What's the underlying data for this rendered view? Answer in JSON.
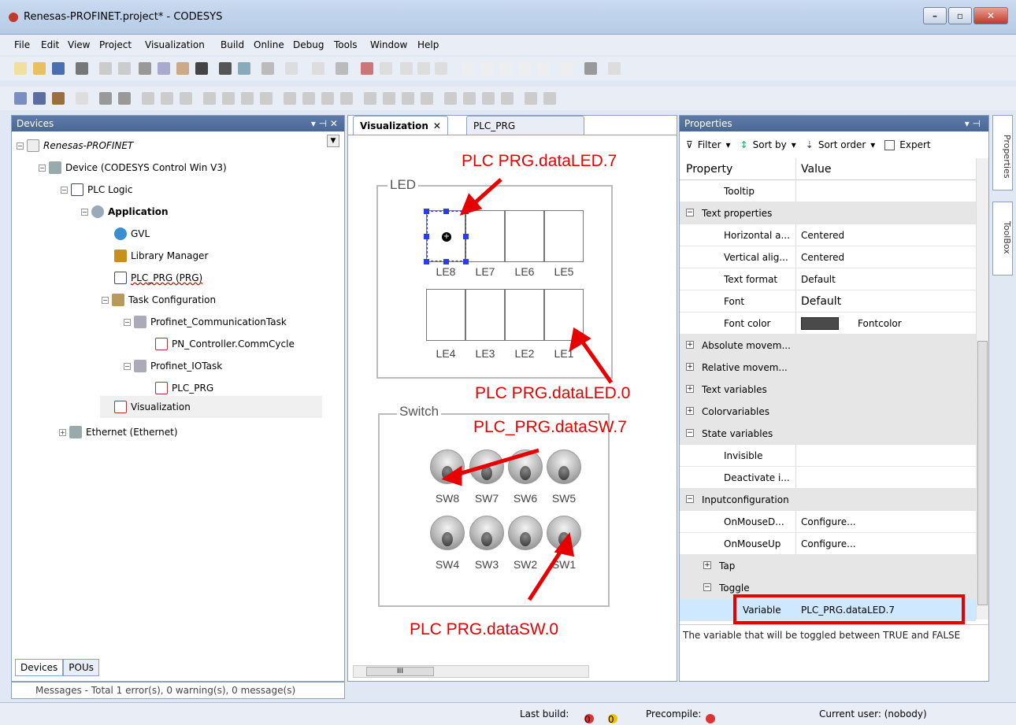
{
  "window": {
    "title": "Renesas-PROFINET.project* - CODESYS",
    "controls": {
      "minimize": "–",
      "maximize": "▫",
      "close": "✕"
    }
  },
  "menu": [
    "File",
    "Edit",
    "View",
    "Project",
    "Visualization",
    "Build",
    "Online",
    "Debug",
    "Tools",
    "Window",
    "Help"
  ],
  "devices_panel": {
    "title": "Devices",
    "tree": [
      {
        "label": "Renesas-PROFINET",
        "icon": "project-icon"
      },
      {
        "label": "Device (CODESYS Control Win V3)",
        "icon": "device-icon"
      },
      {
        "label": "PLC Logic",
        "icon": "plc-logic-icon"
      },
      {
        "label": "Application",
        "icon": "application-gear-icon"
      },
      {
        "label": "GVL",
        "icon": "globe-icon"
      },
      {
        "label": "Library Manager",
        "icon": "books-icon"
      },
      {
        "label": "PLC_PRG (PRG)",
        "icon": "pou-icon"
      },
      {
        "label": "Task Configuration",
        "icon": "task-config-icon"
      },
      {
        "label": "Profinet_CommunicationTask",
        "icon": "task-icon"
      },
      {
        "label": "PN_Controller.CommCycle",
        "icon": "program-call-icon"
      },
      {
        "label": "Profinet_IOTask",
        "icon": "task-icon"
      },
      {
        "label": "PLC_PRG",
        "icon": "program-call-icon"
      },
      {
        "label": "Visualization",
        "icon": "visualization-icon"
      },
      {
        "label": "Ethernet (Ethernet)",
        "icon": "ethernet-icon"
      }
    ],
    "bottom_tabs": [
      "Devices",
      "POUs"
    ]
  },
  "editor": {
    "tabs": [
      "Visualization",
      "PLC_PRG"
    ],
    "led_group": {
      "label": "LED",
      "top_row": [
        "LE8",
        "LE7",
        "LE6",
        "LE5"
      ],
      "bottom_row": [
        "LE4",
        "LE3",
        "LE2",
        "LE1"
      ]
    },
    "switch_group": {
      "label": "Switch",
      "top_row": [
        "SW8",
        "SW7",
        "SW6",
        "SW5"
      ],
      "bottom_row": [
        "SW4",
        "SW3",
        "SW2",
        "SW1"
      ]
    },
    "scroll_mark": "III",
    "annotations": {
      "led7": "PLC  PRG.dataLED.7",
      "led0": "PLC  PRG.dataLED.0",
      "sw7": "PLC_PRG.dataSW.7",
      "sw0": "PLC  PRG.dataSW.0"
    }
  },
  "properties": {
    "title": "Properties",
    "toolbar": {
      "filter": "Filter",
      "sort_by": "Sort by",
      "sort_order": "Sort order",
      "expert": "Expert"
    },
    "columns": [
      "Property",
      "Value"
    ],
    "rows": [
      {
        "name": "Tooltip",
        "value": ""
      },
      {
        "name": "Text properties",
        "value": ""
      },
      {
        "name": "Horizontal a...",
        "value": "Centered"
      },
      {
        "name": "Vertical alig...",
        "value": "Centered"
      },
      {
        "name": "Text format",
        "value": "Default"
      },
      {
        "name": "Font",
        "value": "Default"
      },
      {
        "name": "Font color",
        "value": "Fontcolor"
      },
      {
        "name": "Absolute movem...",
        "value": ""
      },
      {
        "name": "Relative movem...",
        "value": ""
      },
      {
        "name": "Text variables",
        "value": ""
      },
      {
        "name": "Colorvariables",
        "value": ""
      },
      {
        "name": "State variables",
        "value": ""
      },
      {
        "name": "Invisible",
        "value": ""
      },
      {
        "name": "Deactivate i...",
        "value": ""
      },
      {
        "name": "Inputconfiguration",
        "value": ""
      },
      {
        "name": "OnMouseD...",
        "value": "Configure..."
      },
      {
        "name": "OnMouseUp",
        "value": "Configure..."
      },
      {
        "name": "Tap",
        "value": ""
      },
      {
        "name": "Toggle",
        "value": ""
      },
      {
        "name": "Variable",
        "value": "PLC_PRG.dataLED.7"
      }
    ],
    "description": "The variable that will be toggled between TRUE and FALSE",
    "font_color_swatch": "#4a4a4a"
  },
  "side_tabs": [
    "Properties",
    "ToolBox"
  ],
  "messages": "Messages - Total 1 error(s), 0 warning(s), 0 message(s)",
  "status": {
    "last_build": "Last build:",
    "errors": "0",
    "warnings": "0",
    "precompile": "Precompile:",
    "user": "Current user: (nobody)"
  },
  "colors": {
    "accent": "#e60000",
    "selection": "#cde8ff",
    "pane_header": "#4a6896"
  }
}
